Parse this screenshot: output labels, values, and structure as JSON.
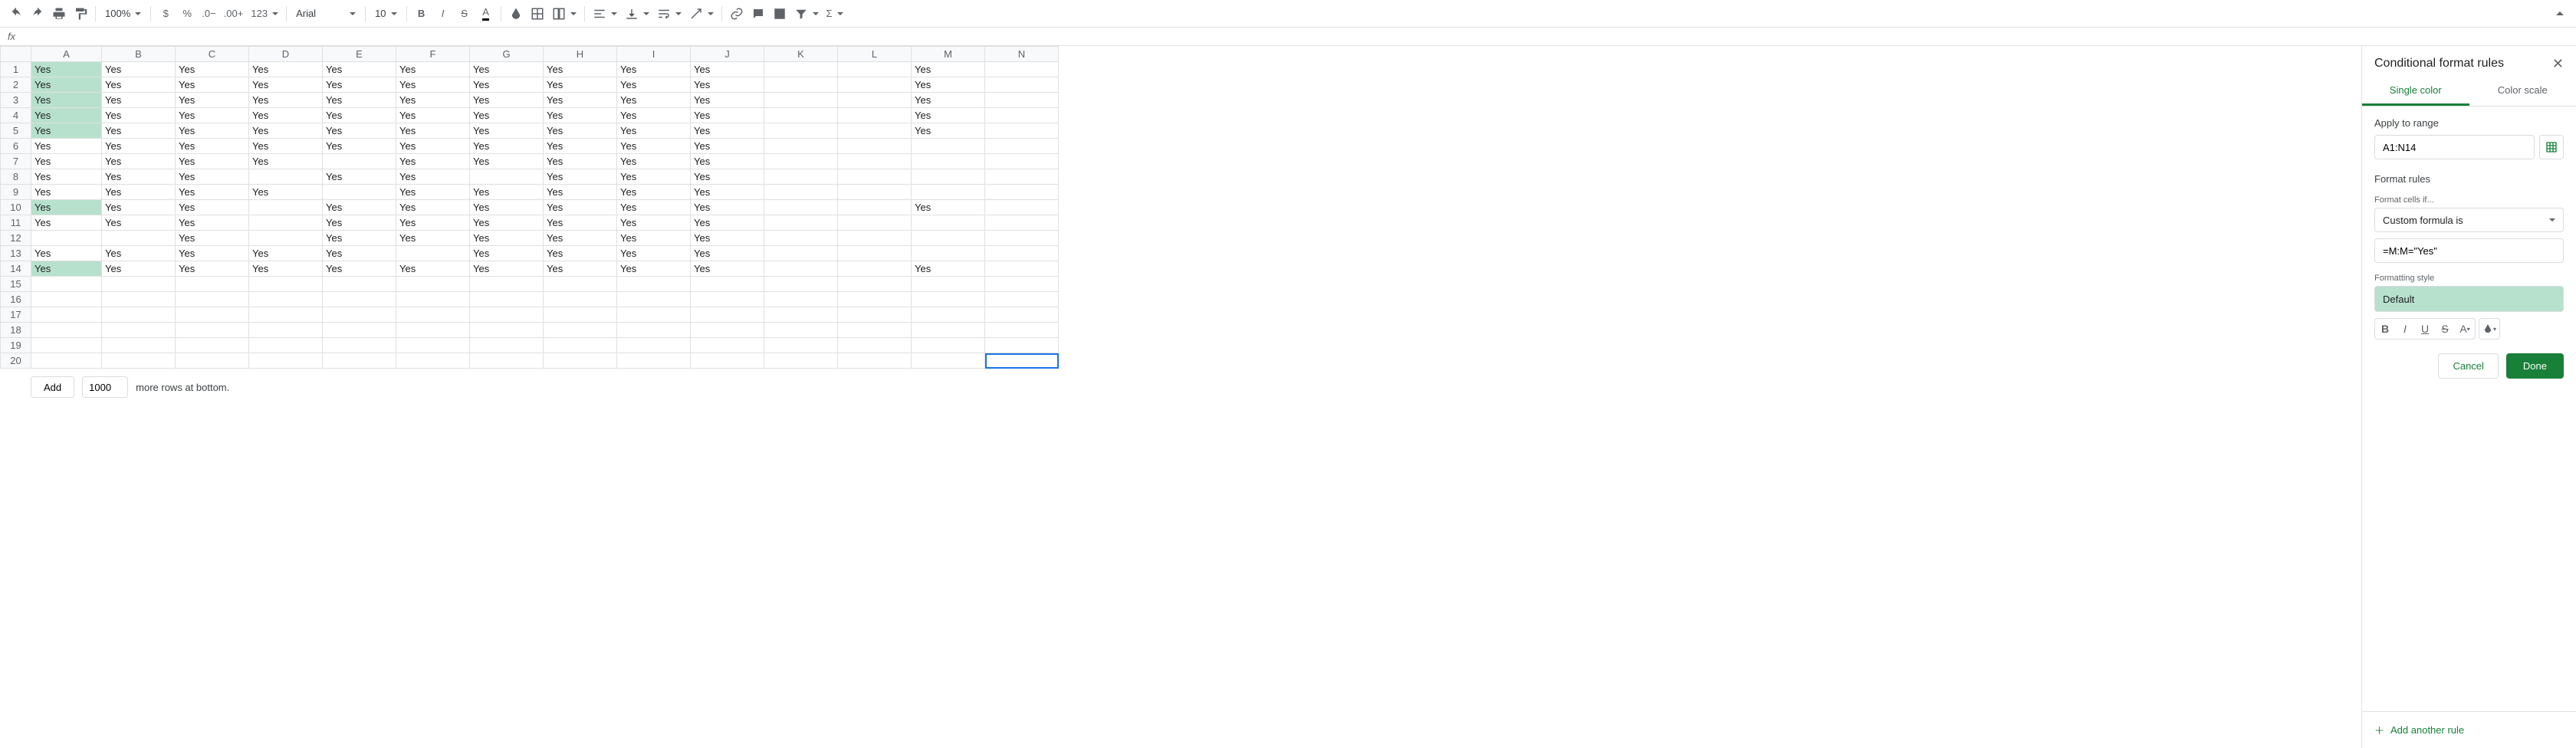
{
  "toolbar": {
    "zoom": "100%",
    "number_format_123": "123",
    "font": "Arial",
    "font_size": "10"
  },
  "formula_bar": {
    "fx_label": "fx",
    "value": ""
  },
  "sheet": {
    "columns": [
      "A",
      "B",
      "C",
      "D",
      "E",
      "F",
      "G",
      "H",
      "I",
      "J",
      "K",
      "L",
      "M",
      "N"
    ],
    "num_rows": 20,
    "selected_cell": {
      "row": 20,
      "col": "N"
    },
    "cf_highlight_cells": [
      "A1",
      "A2",
      "A3",
      "A4",
      "A5",
      "A10",
      "A14"
    ],
    "data": {
      "1": {
        "A": "Yes",
        "B": "Yes",
        "C": "Yes",
        "D": "Yes",
        "E": "Yes",
        "F": "Yes",
        "G": "Yes",
        "H": "Yes",
        "I": "Yes",
        "J": "Yes",
        "M": "Yes"
      },
      "2": {
        "A": "Yes",
        "B": "Yes",
        "C": "Yes",
        "D": "Yes",
        "E": "Yes",
        "F": "Yes",
        "G": "Yes",
        "H": "Yes",
        "I": "Yes",
        "J": "Yes",
        "M": "Yes"
      },
      "3": {
        "A": "Yes",
        "B": "Yes",
        "C": "Yes",
        "D": "Yes",
        "E": "Yes",
        "F": "Yes",
        "G": "Yes",
        "H": "Yes",
        "I": "Yes",
        "J": "Yes",
        "M": "Yes"
      },
      "4": {
        "A": "Yes",
        "B": "Yes",
        "C": "Yes",
        "D": "Yes",
        "E": "Yes",
        "F": "Yes",
        "G": "Yes",
        "H": "Yes",
        "I": "Yes",
        "J": "Yes",
        "M": "Yes"
      },
      "5": {
        "A": "Yes",
        "B": "Yes",
        "C": "Yes",
        "D": "Yes",
        "E": "Yes",
        "F": "Yes",
        "G": "Yes",
        "H": "Yes",
        "I": "Yes",
        "J": "Yes",
        "M": "Yes"
      },
      "6": {
        "A": "Yes",
        "B": "Yes",
        "C": "Yes",
        "D": "Yes",
        "E": "Yes",
        "F": "Yes",
        "G": "Yes",
        "H": "Yes",
        "I": "Yes",
        "J": "Yes"
      },
      "7": {
        "A": "Yes",
        "B": "Yes",
        "C": "Yes",
        "D": "Yes",
        "F": "Yes",
        "G": "Yes",
        "H": "Yes",
        "I": "Yes",
        "J": "Yes"
      },
      "8": {
        "A": "Yes",
        "B": "Yes",
        "C": "Yes",
        "E": "Yes",
        "F": "Yes",
        "H": "Yes",
        "I": "Yes",
        "J": "Yes"
      },
      "9": {
        "A": "Yes",
        "B": "Yes",
        "C": "Yes",
        "D": "Yes",
        "F": "Yes",
        "G": "Yes",
        "H": "Yes",
        "I": "Yes",
        "J": "Yes"
      },
      "10": {
        "A": "Yes",
        "B": "Yes",
        "C": "Yes",
        "E": "Yes",
        "F": "Yes",
        "G": "Yes",
        "H": "Yes",
        "I": "Yes",
        "J": "Yes",
        "M": "Yes"
      },
      "11": {
        "A": "Yes",
        "B": "Yes",
        "C": "Yes",
        "E": "Yes",
        "F": "Yes",
        "G": "Yes",
        "H": "Yes",
        "I": "Yes",
        "J": "Yes"
      },
      "12": {
        "C": "Yes",
        "E": "Yes",
        "F": "Yes",
        "G": "Yes",
        "H": "Yes",
        "I": "Yes",
        "J": "Yes"
      },
      "13": {
        "A": "Yes",
        "B": "Yes",
        "C": "Yes",
        "D": "Yes",
        "E": "Yes",
        "G": "Yes",
        "H": "Yes",
        "I": "Yes",
        "J": "Yes"
      },
      "14": {
        "A": "Yes",
        "B": "Yes",
        "C": "Yes",
        "D": "Yes",
        "E": "Yes",
        "F": "Yes",
        "G": "Yes",
        "H": "Yes",
        "I": "Yes",
        "J": "Yes",
        "M": "Yes"
      }
    }
  },
  "footer": {
    "add_label": "Add",
    "rows_count": "1000",
    "more_rows_label": "more rows at bottom."
  },
  "sidepanel": {
    "title": "Conditional format rules",
    "tabs": {
      "single": "Single color",
      "scale": "Color scale"
    },
    "apply_range_label": "Apply to range",
    "apply_range_value": "A1:N14",
    "format_rules_label": "Format rules",
    "format_cells_if_label": "Format cells if...",
    "condition_value": "Custom formula is",
    "formula_value": "=M:M=\"Yes\"",
    "formatting_style_label": "Formatting style",
    "style_preview_label": "Default",
    "cancel_label": "Cancel",
    "done_label": "Done",
    "add_rule_label": "Add another rule"
  }
}
